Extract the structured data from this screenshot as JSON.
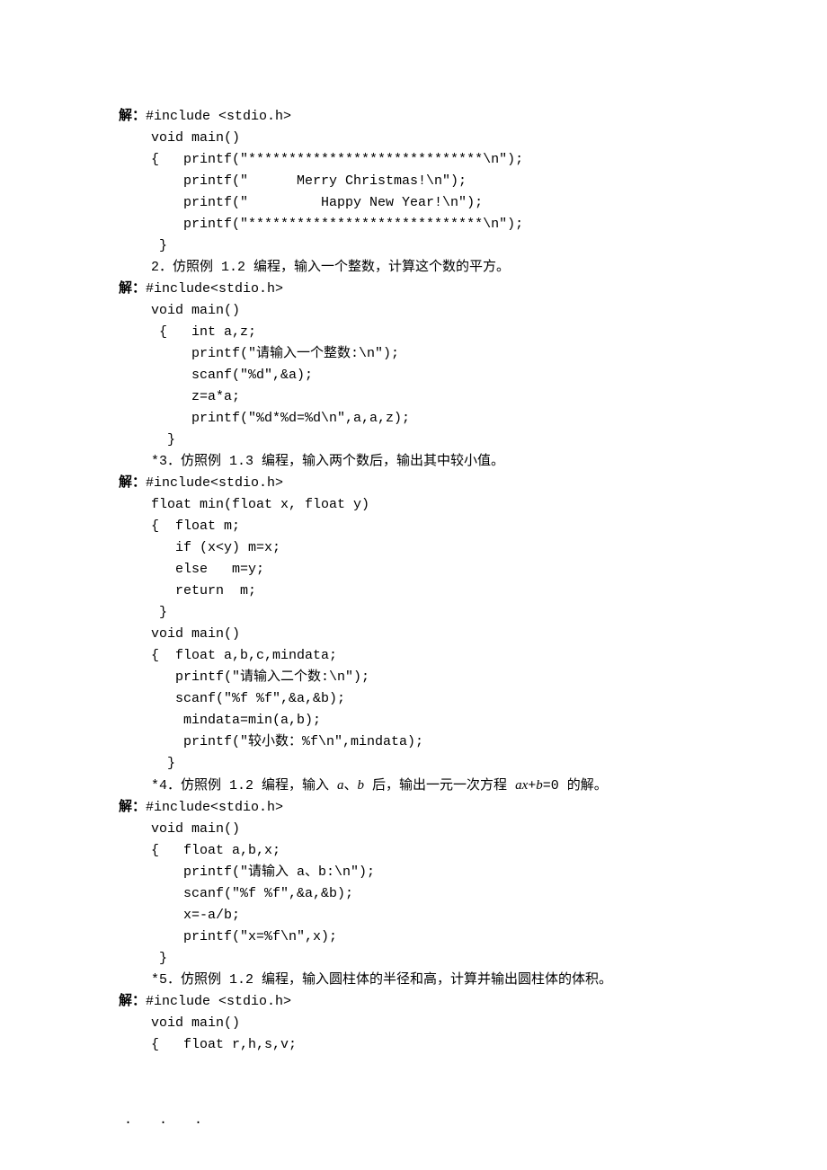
{
  "lines": [
    {
      "text": "解：",
      "bold": true,
      "suffix": "#include <stdio.h>"
    },
    {
      "text": "    void main()"
    },
    {
      "text": "    {   printf(\"*****************************\\n\");"
    },
    {
      "text": "        printf(\"      Merry Christmas!\\n\");"
    },
    {
      "text": "        printf(\"         Happy New Year!\\n\");"
    },
    {
      "text": "        printf(\"*****************************\\n\");"
    },
    {
      "text": "     }"
    },
    {
      "text": "    2．仿照例 1.2 编程，输入一个整数，计算这个数的平方。"
    },
    {
      "text": "解：",
      "bold": true,
      "suffix": "#include<stdio.h>"
    },
    {
      "text": "    void main()"
    },
    {
      "text": "     {   int a,z;"
    },
    {
      "text": "         printf(\"请输入一个整数:\\n\");"
    },
    {
      "text": "         scanf(\"%d\",&a);"
    },
    {
      "text": "         z=a*a;"
    },
    {
      "text": "         printf(\"%d*%d=%d\\n\",a,a,z);"
    },
    {
      "text": "      }"
    },
    {
      "text": "    *3．仿照例 1.3 编程，输入两个数后，输出其中较小值。"
    },
    {
      "text": "解：",
      "bold": true,
      "suffix": "#include<stdio.h>"
    },
    {
      "text": "    float min(float x, float y)"
    },
    {
      "text": "    {  float m;"
    },
    {
      "text": "       if (x<y) m=x;"
    },
    {
      "text": "       else   m=y;"
    },
    {
      "text": "       return  m;"
    },
    {
      "text": "     }"
    },
    {
      "text": "    void main()"
    },
    {
      "text": "    {  float a,b,c,mindata;"
    },
    {
      "text": "       printf(\"请输入二个数:\\n\");"
    },
    {
      "text": "       scanf(\"%f %f\",&a,&b);"
    },
    {
      "text": "        mindata=min(a,b);"
    },
    {
      "text": "        printf(\"较小数：%f\\n\",mindata);"
    },
    {
      "text": "      }"
    },
    {
      "text": "    *4．仿照例 1.2 编程，输入 ",
      "suffix_italic": "a",
      "mid": "、",
      "suffix_italic2": "b",
      "mid2": " 后，输出一元一次方程 ",
      "suffix_italic3": "ax",
      "mid3": "+",
      "suffix_italic4": "b",
      "mid4": "=0 的解。"
    },
    {
      "text": "解：",
      "bold": true,
      "suffix": "#include<stdio.h>"
    },
    {
      "text": "    void main()"
    },
    {
      "text": "    {   float a,b,x;"
    },
    {
      "text": "        printf(\"请输入 a、b:\\n\");"
    },
    {
      "text": "        scanf(\"%f %f\",&a,&b);"
    },
    {
      "text": "        x=-a/b;"
    },
    {
      "text": "        printf(\"x=%f\\n\",x);"
    },
    {
      "text": "     }"
    },
    {
      "text": "    *5．仿照例 1.2 编程，输入圆柱体的半径和高，计算并输出圆柱体的体积。"
    },
    {
      "text": "解：",
      "bold": true,
      "suffix": "#include <stdio.h>"
    },
    {
      "text": "    void main()"
    },
    {
      "text": "    {   float r,h,s,v;"
    }
  ],
  "footer": "..."
}
